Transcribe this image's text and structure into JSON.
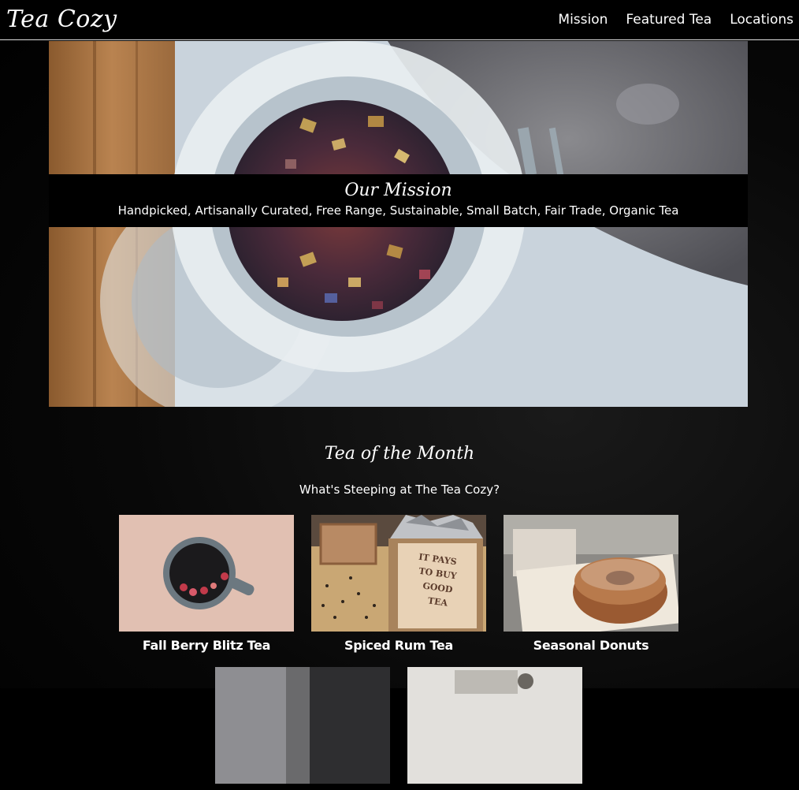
{
  "header": {
    "logo": "Tea Cozy",
    "nav": [
      "Mission",
      "Featured Tea",
      "Locations"
    ]
  },
  "hero": {
    "image": "tea-jar-photo",
    "title": "Our Mission",
    "text": "Handpicked, Artisanally Curated, Free Range, Sustainable, Small Batch, Fair Trade, Organic Tea"
  },
  "month": {
    "title": "Tea of the Month",
    "subtitle": "What's Steeping at The Tea Cozy?",
    "items": [
      {
        "label": "Fall Berry Blitz Tea",
        "image": "berry-tea-mug-photo"
      },
      {
        "label": "Spiced Rum Tea",
        "image": "tea-box-photo"
      },
      {
        "label": "Seasonal Donuts",
        "image": "donut-photo"
      },
      {
        "label": "",
        "image": "partial-photo-4"
      },
      {
        "label": "",
        "image": "partial-photo-5"
      }
    ]
  },
  "colors": {
    "background": "#000000",
    "text": "#ffffff",
    "header_border": "#dddddd"
  }
}
